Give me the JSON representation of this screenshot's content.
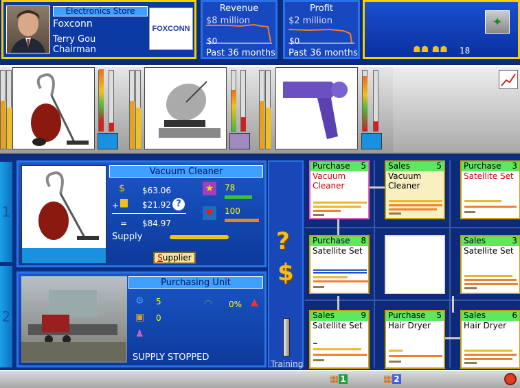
{
  "company": {
    "store_type": "Electronics Store",
    "name": "Foxconn",
    "ceo": "Terry Gou",
    "title": "Chairman",
    "logo_text": "FOXCONN"
  },
  "revenue": {
    "title": "Revenue",
    "top": "$8 million",
    "bottom": "$0",
    "period": "Past 36 months"
  },
  "profit": {
    "title": "Profit",
    "top": "$2 million",
    "bottom": "$0",
    "period": "Past 36 months"
  },
  "status": {
    "people_count": "18"
  },
  "detail": {
    "product": "Vacuum Cleaner",
    "price1": "$63.06",
    "price2": "$21.92",
    "total": "$84.97",
    "plus": "+",
    "equals": "=",
    "help": "?",
    "quality": "78",
    "brand": "100",
    "supply_label": "Supply",
    "supplier_btn_prefix": "S",
    "supplier_btn_rest": "upplier"
  },
  "purchasing": {
    "title": "Purchasing Unit",
    "v1": "5",
    "v2": "0",
    "pct": "0%",
    "status": "SUPPLY STOPPED"
  },
  "side_tabs": [
    "1",
    "2"
  ],
  "training_label": "Training",
  "question": "?",
  "dollar": "$",
  "cards": [
    {
      "type": "Purchase",
      "level": "5",
      "item": "Vacuum Cleaner",
      "red": true
    },
    {
      "type": "Sales",
      "level": "5",
      "item": "Vacuum Cleaner",
      "red": false
    },
    {
      "type": "Purchase",
      "level": "3",
      "item": "Satellite Set",
      "red": true
    },
    {
      "type": "Purchase",
      "level": "8",
      "item": "Satellite Set",
      "red": false
    },
    {
      "type": "",
      "level": "",
      "item": "",
      "red": false
    },
    {
      "type": "Sales",
      "level": "3",
      "item": "Satellite Set",
      "red": false
    },
    {
      "type": "Sales",
      "level": "9",
      "item": "Satellite Set",
      "red": false
    },
    {
      "type": "Purchase",
      "level": "5",
      "item": "Hair Dryer",
      "red": false
    },
    {
      "type": "Sales",
      "level": "6",
      "item": "Hair Dryer",
      "red": false
    }
  ],
  "bottom_tabs": [
    "1",
    "2"
  ]
}
